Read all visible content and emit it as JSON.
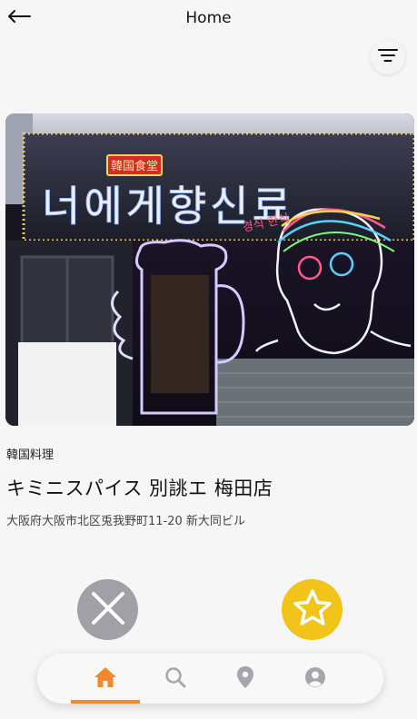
{
  "header": {
    "title": "Home",
    "back_icon": "arrow-left-icon",
    "filter_icon": "filter-lines-icon"
  },
  "restaurant": {
    "category": "韓国料理",
    "name": "キミニスパイス 別誂エ 梅田店",
    "address": "大阪府大阪市北区兎我野町11-20 新大同ビル",
    "photo": {
      "sign_hangul": "너에게향신료",
      "sign_kanji": "韓国食堂",
      "neon_text": "경식 한식"
    }
  },
  "actions": {
    "dislike_icon": "close-x-icon",
    "like_icon": "star-icon"
  },
  "bottom_nav": {
    "items": [
      {
        "name": "home",
        "icon": "home-icon",
        "active": true
      },
      {
        "name": "search",
        "icon": "search-icon",
        "active": false
      },
      {
        "name": "map",
        "icon": "map-pin-icon",
        "active": false
      },
      {
        "name": "profile",
        "icon": "user-icon",
        "active": false
      }
    ]
  },
  "colors": {
    "background": "#f6f6f6",
    "accent": "#f08a2a",
    "like": "#f2c319",
    "dislike": "#a0a0a6",
    "inactive_icon": "#a5a5ab"
  }
}
